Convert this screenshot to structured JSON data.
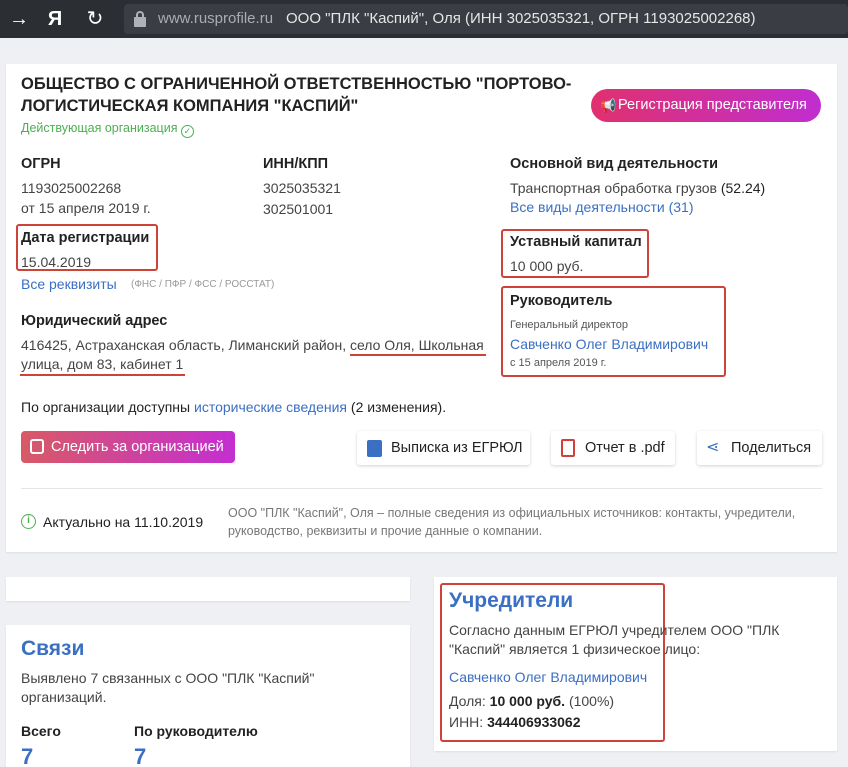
{
  "browser": {
    "back_icon": "→",
    "yandex_icon": "Я",
    "reload_icon": "↻",
    "url_domain": "www.rusprofile.ru",
    "page_title": "ООО \"ПЛК \"Каспий\", Оля (ИНН 3025035321, ОГРН 1193025002268)"
  },
  "company": {
    "name_line1": "ОБЩЕСТВО С ОГРАНИЧЕННОЙ ОТВЕТСТВЕННОСТЬЮ \"ПОРТОВО-",
    "name_line2": "ЛОГИСТИЧЕСКАЯ КОМПАНИЯ \"КАСПИЙ\"",
    "status": "Действующая организация",
    "register_rep_button": "Регистрация представителя",
    "ogrn_label": "ОГРН",
    "ogrn_value": "1193025002268",
    "ogrn_date": "от 15 апреля 2019 г.",
    "inn_label": "ИНН/КПП",
    "inn_value": "3025035321",
    "kpp_value": "302501001",
    "activity_label": "Основной вид деятельности",
    "activity_value": "Транспортная обработка грузов",
    "activity_code": "(52.24)",
    "activity_all_link": "Все виды деятельности (31)",
    "reg_date_label": "Дата регистрации",
    "reg_date_value": "15.04.2019",
    "capital_label": "Уставный капитал",
    "capital_value": "10 000 руб.",
    "all_details_link": "Все реквизиты",
    "all_details_sources": "(ФНС / ПФР / ФСС / РОССТАТ)",
    "director_label": "Руководитель",
    "director_position": "Генеральный директор",
    "director_name": "Савченко Олег Владимирович",
    "director_since": "с 15 апреля 2019 г.",
    "address_label": "Юридический адрес",
    "address_line1_a": "416425, Астраханская область, Лиманский район, ",
    "address_line1_b": "село Оля, Школьная",
    "address_line2": "улица, дом 83, кабинет 1",
    "history_prefix": "По организации доступны ",
    "history_link": "исторические сведения",
    "history_suffix": " (2 изменения).",
    "follow_button": "Следить за организацией",
    "egrul_button": "Выписка из ЕГРЮЛ",
    "pdf_button": "Отчет в .pdf",
    "share_button": "Поделиться",
    "actual_text": "Актуально на 11.10.2019",
    "info_line1": "ООО \"ПЛК \"Каспий\", Оля – полные сведения из официальных источников: контакты, учредители,",
    "info_line2": "руководство, реквизиты и прочие данные о компании."
  },
  "links": {
    "title": "Связи",
    "desc_line1": "Выявлено 7 связанных с ООО \"ПЛК \"Каспий\"",
    "desc_line2": "организаций.",
    "total_label": "Всего",
    "total_value": "7",
    "by_director_label": "По руководителю",
    "by_director_value": "7"
  },
  "founders": {
    "title": "Учредители",
    "desc_line1": "Согласно данным ЕГРЮЛ учредителем ООО \"ПЛК",
    "desc_line2": "\"Каспий\" является 1 физическое лицо:",
    "founder_name": "Савченко Олег Владимирович",
    "share_label": "Доля: ",
    "share_value": "10 000 руб.",
    "share_percent": " (100%)",
    "inn_label": "ИНН: ",
    "inn_value": "344406933062"
  },
  "colors": {
    "accent_link": "#3a6fc4",
    "highlight_red": "#d0413a",
    "status_green": "#4caf50"
  }
}
